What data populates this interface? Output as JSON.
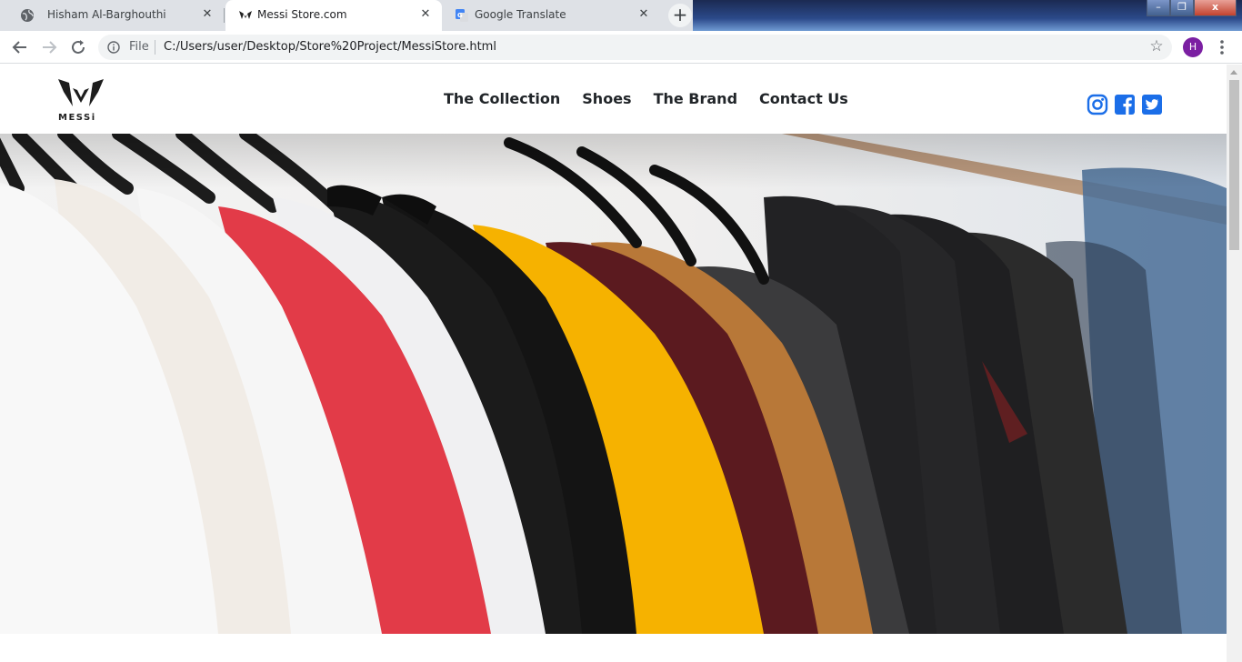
{
  "browser": {
    "tabs": [
      {
        "title": "Hisham Al-Barghouthi",
        "icon": "globe-icon",
        "active": false
      },
      {
        "title": "Messi Store.com",
        "icon": "messi-logo-icon",
        "active": true
      },
      {
        "title": "Google Translate",
        "icon": "google-translate-icon",
        "active": false
      }
    ],
    "new_tab_label": "+",
    "omnibox": {
      "scheme_label": "File",
      "url": "C:/Users/user/Desktop/Store%20Project/MessiStore.html"
    },
    "profile_initial": "H",
    "window_controls": {
      "minimize": "–",
      "maximize": "❐",
      "close": "x"
    }
  },
  "site": {
    "logo_text": "MESSi",
    "nav": [
      "The Collection",
      "Shoes",
      "The Brand",
      "Contact Us"
    ],
    "socials": [
      "instagram-icon",
      "facebook-icon",
      "twitter-icon"
    ],
    "social_color": "#1b6ee8",
    "hero_image": "clothing-rack-photo"
  }
}
